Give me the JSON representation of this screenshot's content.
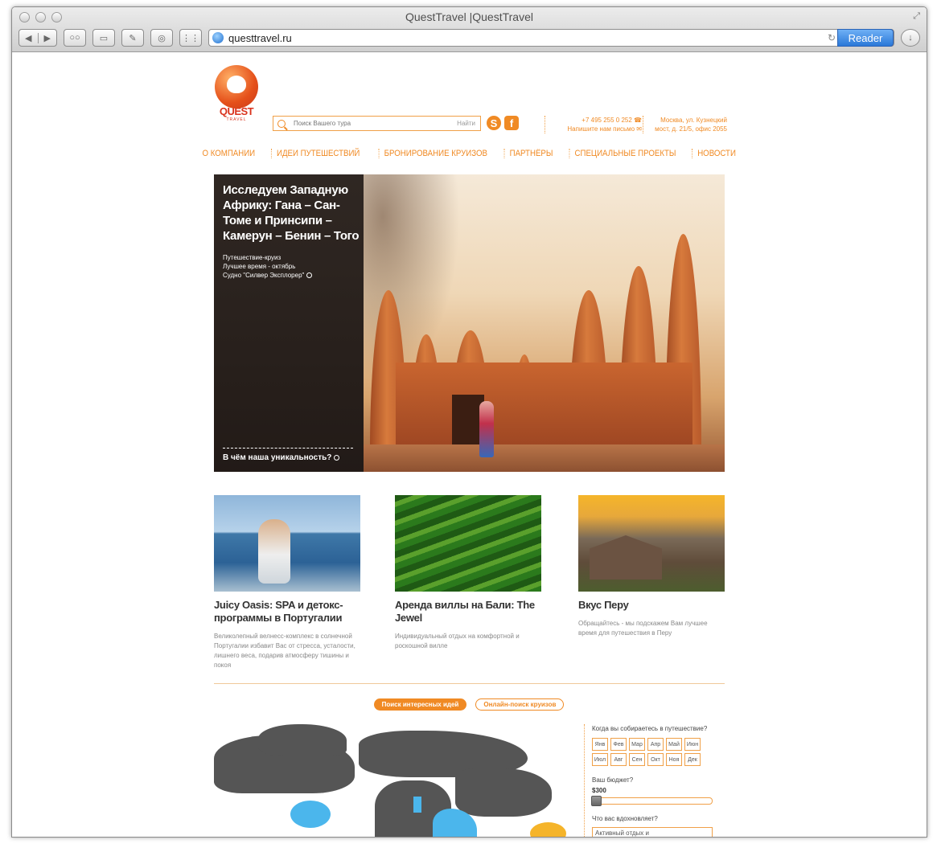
{
  "browser": {
    "title": "QuestTravel |QuestTravel",
    "url": "questtravel.ru",
    "reader_label": "Reader"
  },
  "header": {
    "logo_text": "QUEST",
    "logo_sub": "TRAVEL",
    "search_placeholder": "Поиск Вашего тура",
    "search_button": "Найти",
    "phone": "+7 495 255 0 252",
    "write_us": "Напишите нам письмо",
    "address_line1": "Москва, ул. Кузнецкий",
    "address_line2": "мост, д. 21/5, офис 2055"
  },
  "nav": [
    "О КОМПАНИИ",
    "ИДЕИ ПУТЕШЕСТВИЙ",
    "БРОНИРОВАНИЕ КРУИЗОВ",
    "ПАРТНЁРЫ",
    "СПЕЦИАЛЬНЫЕ ПРОЕКТЫ",
    "НОВОСТИ"
  ],
  "hero": {
    "title": "Исследуем Западную Африку: Гана – Сан-Томе и Принсипи – Камерун – Бенин – Того",
    "info1": "Путешествие-круиз",
    "info2": "Лучшее время - октябрь",
    "info3": "Судно \"Силвер Эксплорер\"",
    "link": "В чём наша уникальность?"
  },
  "cards": [
    {
      "title": "Juicy Oasis: SPA и детокс-программы в Португалии",
      "desc": "Великолепный велнесс-комплекс в солнечной Португалии избавит Вас от стресса, усталости, лишнего веса, подарив атмосферу тишины и покоя"
    },
    {
      "title": "Аренда виллы на Бали: The Jewel",
      "desc": "Индивидуальный отдых на комфортной и роскошной вилле"
    },
    {
      "title": "Вкус Перу",
      "desc": "Обращайтесь - мы подскажем Вам лучшее время для путешествия в Перу"
    }
  ],
  "tabs": {
    "ideas": "Поиск интересных идей",
    "cruises": "Онлайн-поиск круизов"
  },
  "finder": {
    "when_label": "Когда вы собираетесь в путешествие?",
    "months": [
      "Янв",
      "Фев",
      "Мар",
      "Апр",
      "Май",
      "Июн",
      "Июл",
      "Авг",
      "Сен",
      "Окт",
      "Ноя",
      "Дек"
    ],
    "budget_label": "Ваш бюджет?",
    "budget_value": "$300",
    "inspire_label": "Что вас вдохновляет?",
    "inspire_value": "Активный отдых и"
  },
  "colors": {
    "accent": "#f08a24",
    "map_land": "#555555",
    "map_water": "#4bb6ec"
  }
}
